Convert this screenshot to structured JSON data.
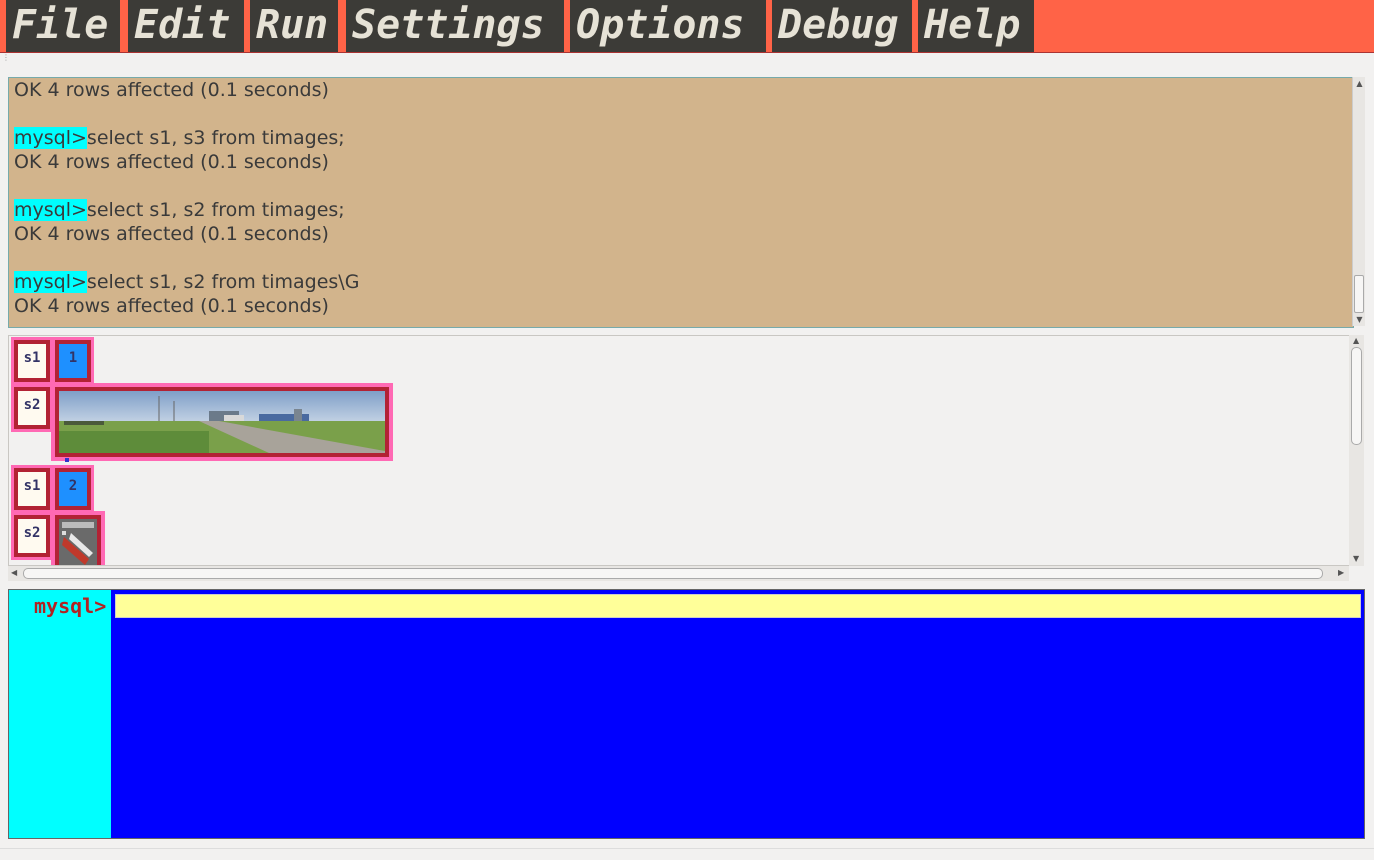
{
  "menu": {
    "items": [
      "File",
      "Edit",
      "Run",
      "Settings",
      "Options",
      "Debug",
      "Help"
    ]
  },
  "log": {
    "lines": [
      {
        "prompt": "mysql>",
        "text": "select s1, s3 from timages;"
      },
      {
        "prompt": "",
        "text": "OK 4 rows affected (0.1 seconds)"
      },
      {
        "prompt": "",
        "text": ""
      },
      {
        "prompt": "mysql>",
        "text": "select s1, s3 from timages;"
      },
      {
        "prompt": "",
        "text": "OK 4 rows affected (0.1 seconds)"
      },
      {
        "prompt": "",
        "text": ""
      },
      {
        "prompt": "mysql>",
        "text": "select s1, s2 from timages;"
      },
      {
        "prompt": "",
        "text": "OK 4 rows affected (0.1 seconds)"
      },
      {
        "prompt": "",
        "text": ""
      },
      {
        "prompt": "mysql>",
        "text": "select s1, s2 from timages\\G"
      },
      {
        "prompt": "",
        "text": "OK 4 rows affected (0.1 seconds)"
      }
    ]
  },
  "results": {
    "rows": [
      {
        "label": "s1",
        "value": "1"
      },
      {
        "label": "s2",
        "image": "panorama-field-road"
      },
      {
        "label": "s1",
        "value": "2"
      },
      {
        "label": "s2",
        "image": "book-cover-thumbnail"
      }
    ]
  },
  "input": {
    "prompt": "mysql>",
    "value": ""
  },
  "colors": {
    "menubar": "#ff6347",
    "menu_item": "#3c3b37",
    "log_bg": "#d2b48c",
    "prompt_highlight": "#00ffff",
    "input_bg": "#0000ff",
    "input_field": "#ffff99"
  }
}
